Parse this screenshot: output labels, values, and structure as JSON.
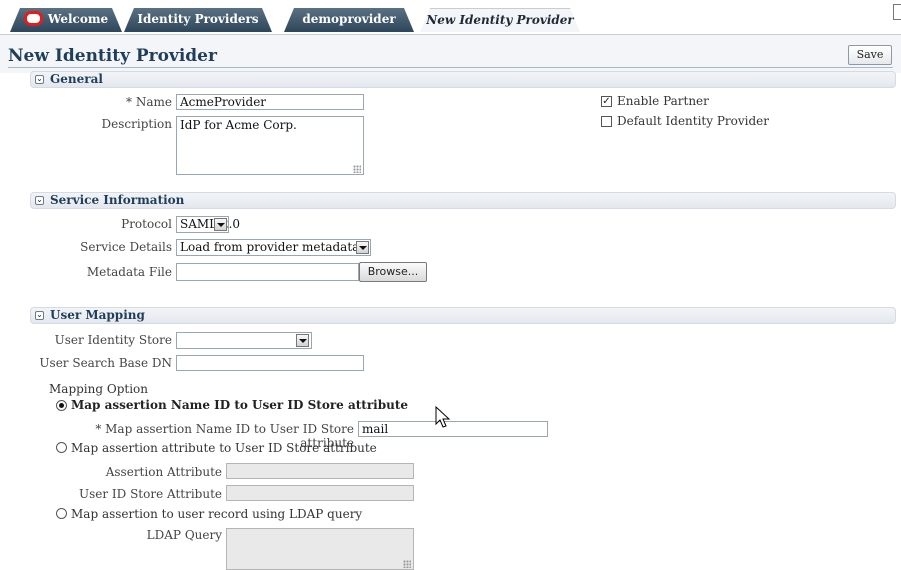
{
  "tabs": [
    {
      "label": "Welcome",
      "active": false
    },
    {
      "label": "Identity Providers",
      "active": false
    },
    {
      "label": "demoprovider",
      "active": false
    },
    {
      "label": "New Identity Provider",
      "active": true
    }
  ],
  "page": {
    "title": "New Identity Provider",
    "save_label": "Save"
  },
  "general": {
    "section_label": "General",
    "name_label": "* Name",
    "name_value": "AcmeProvider",
    "description_label": "Description",
    "description_value": "IdP for Acme Corp.",
    "enable_partner_label": "Enable Partner",
    "enable_partner_checked": true,
    "default_idp_label": "Default Identity Provider",
    "default_idp_checked": false
  },
  "service": {
    "section_label": "Service Information",
    "protocol_label": "Protocol",
    "protocol_value": "SAML 2.0",
    "details_label": "Service Details",
    "details_value": "Load from provider metadata",
    "metadata_label": "Metadata File",
    "metadata_value": "",
    "browse_label": "Browse..."
  },
  "user_mapping": {
    "section_label": "User Mapping",
    "identity_store_label": "User Identity Store",
    "identity_store_value": "",
    "search_base_label": "User Search Base DN",
    "search_base_value": "",
    "mapping_option_label": "Mapping Option",
    "option1_label": "Map assertion Name ID to User ID Store attribute",
    "option1_selected": true,
    "nameid_attr_label": "* Map assertion Name ID to User ID Store attribute",
    "nameid_attr_value": "mail",
    "option2_label": "Map assertion attribute to User ID Store attribute",
    "assertion_attr_label": "Assertion Attribute",
    "user_id_store_attr_label": "User ID Store Attribute",
    "option3_label": "Map assertion to user record using LDAP query",
    "ldap_query_label": "LDAP Query"
  },
  "colors": {
    "tab_dark": "#2e465a",
    "title": "#1f3e5a",
    "brand_red": "#e31c1c"
  }
}
